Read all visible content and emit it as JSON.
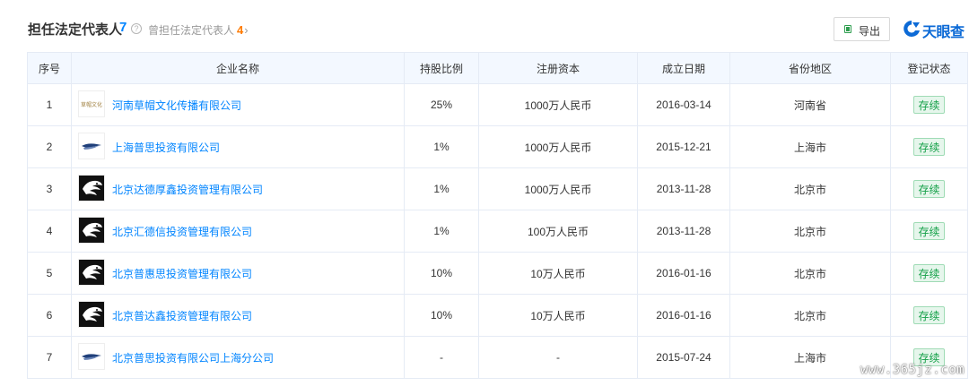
{
  "header": {
    "title": "担任法定代表人",
    "count": "7",
    "help_icon": "?",
    "former_label": "曾担任法定代表人",
    "former_count": "4",
    "former_chevron": "›",
    "export_label": "导出",
    "brand_name": "天眼查"
  },
  "table": {
    "columns": [
      "序号",
      "企业名称",
      "持股比例",
      "注册资本",
      "成立日期",
      "省份地区",
      "登记状态"
    ],
    "rows": [
      {
        "index": "1",
        "name": "河南草帽文化传播有限公司",
        "share": "25%",
        "capital": "1000万人民币",
        "date": "2016-03-14",
        "region": "河南省",
        "status": "存续",
        "logo": "text-logo",
        "logo_text": "草帽文化"
      },
      {
        "index": "2",
        "name": "上海普思投资有限公司",
        "share": "1%",
        "capital": "1000万人民币",
        "date": "2015-12-21",
        "region": "上海市",
        "status": "存续",
        "logo": "wing-logo"
      },
      {
        "index": "3",
        "name": "北京达德厚鑫投资管理有限公司",
        "share": "1%",
        "capital": "1000万人民币",
        "date": "2013-11-28",
        "region": "北京市",
        "status": "存续",
        "logo": "eagle-logo"
      },
      {
        "index": "4",
        "name": "北京汇德信投资管理有限公司",
        "share": "1%",
        "capital": "100万人民币",
        "date": "2013-11-28",
        "region": "北京市",
        "status": "存续",
        "logo": "eagle-logo"
      },
      {
        "index": "5",
        "name": "北京普惠思投资管理有限公司",
        "share": "10%",
        "capital": "10万人民币",
        "date": "2016-01-16",
        "region": "北京市",
        "status": "存续",
        "logo": "eagle-logo"
      },
      {
        "index": "6",
        "name": "北京普达鑫投资管理有限公司",
        "share": "10%",
        "capital": "10万人民币",
        "date": "2016-01-16",
        "region": "北京市",
        "status": "存续",
        "logo": "eagle-logo"
      },
      {
        "index": "7",
        "name": "北京普思投资有限公司上海分公司",
        "share": "-",
        "capital": "-",
        "date": "2015-07-24",
        "region": "上海市",
        "status": "存续",
        "logo": "wing-logo"
      }
    ]
  },
  "watermark": "www.365jz.com",
  "colors": {
    "link": "#0084ff",
    "accent_orange": "#ff7a00",
    "status_green": "#14a048",
    "header_bg": "#f3f8ff",
    "brand_blue": "#0c6ad6"
  }
}
